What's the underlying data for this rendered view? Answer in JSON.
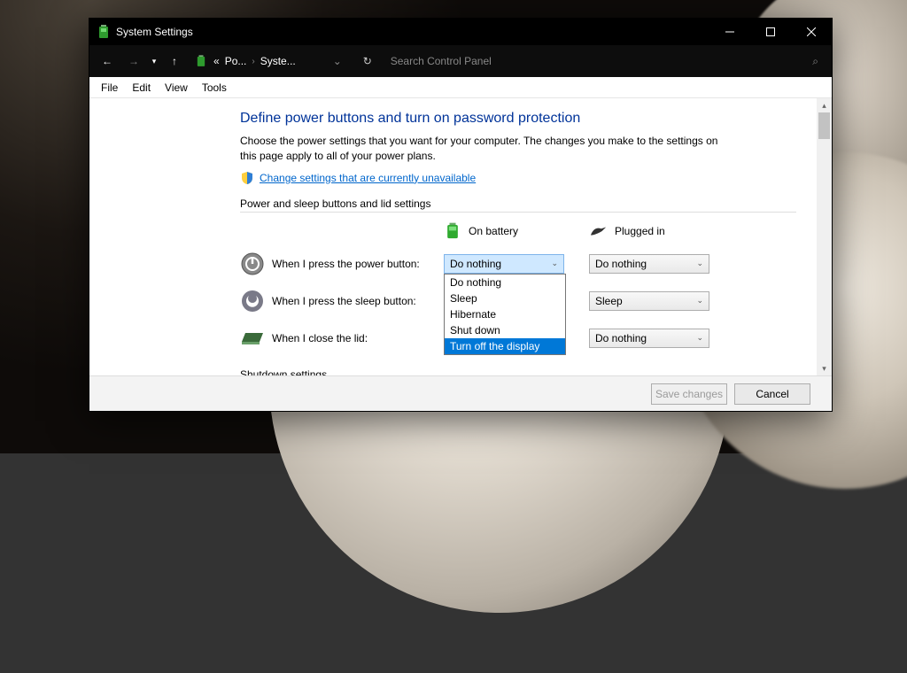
{
  "window": {
    "title": "System Settings"
  },
  "breadcrumbs": {
    "pre": "«",
    "a": "Po...",
    "b": "Syste..."
  },
  "search": {
    "placeholder": "Search Control Panel"
  },
  "menu": {
    "file": "File",
    "edit": "Edit",
    "view": "View",
    "tools": "Tools"
  },
  "page": {
    "title": "Define power buttons and turn on password protection",
    "desc": "Choose the power settings that you want for your computer. The changes you make to the settings on this page apply to all of your power plans.",
    "change_link": "Change settings that are currently unavailable",
    "section1": "Power and sleep buttons and lid settings",
    "section2": "Shutdown settings"
  },
  "headers": {
    "battery": "On battery",
    "plugged": "Plugged in"
  },
  "rows": {
    "power": {
      "label": "When I press the power button:",
      "battery": "Do nothing",
      "plugged": "Do nothing"
    },
    "sleep": {
      "label": "When I press the sleep button:",
      "plugged": "Sleep"
    },
    "lid": {
      "label": "When I close the lid:",
      "plugged": "Do nothing"
    }
  },
  "dropdown": {
    "opt0": "Do nothing",
    "opt1": "Sleep",
    "opt2": "Hibernate",
    "opt3": "Shut down",
    "opt4": "Turn off the display"
  },
  "footer": {
    "save": "Save changes",
    "cancel": "Cancel"
  }
}
